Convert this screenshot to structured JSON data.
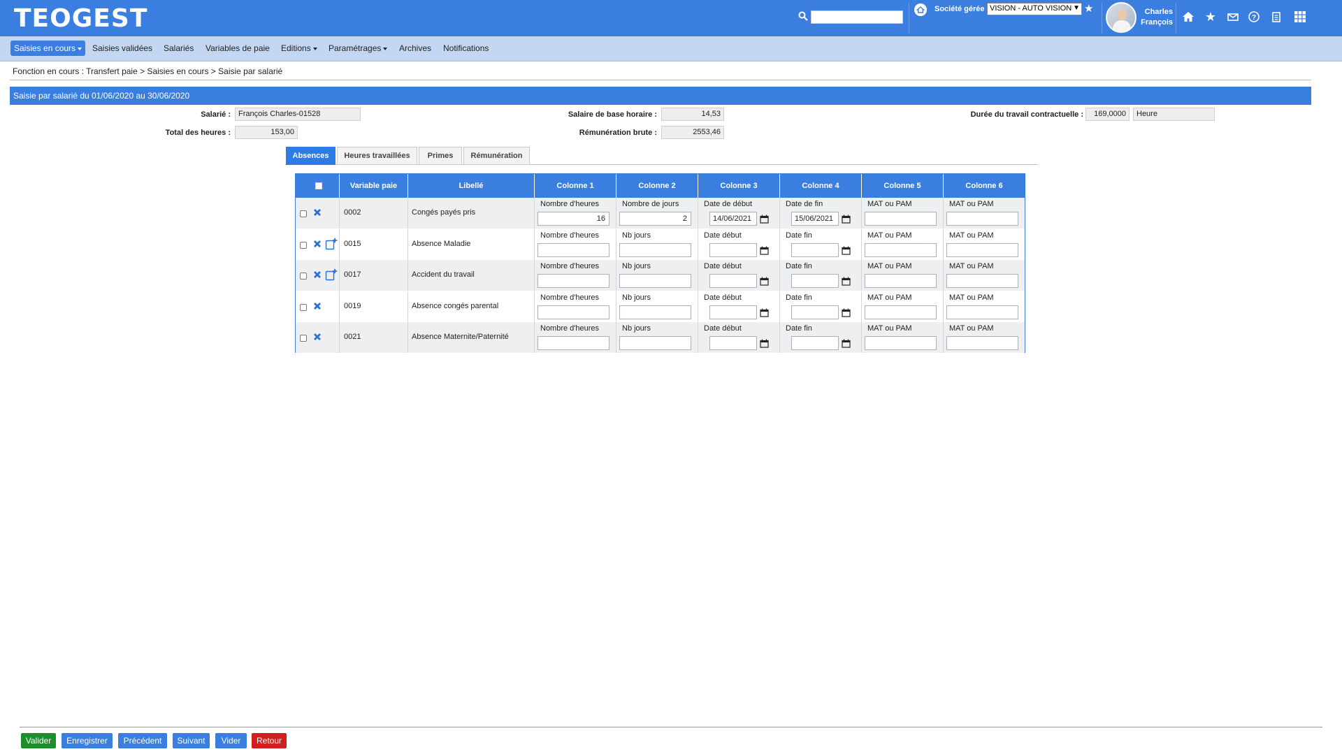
{
  "app": {
    "logo": "TEOGEST"
  },
  "header": {
    "search_placeholder": "",
    "company_label": "Société gérée :",
    "company_value": "VISION - AUTO VISION",
    "user_first": "Charles",
    "user_last": "François"
  },
  "nav": [
    {
      "label": "Saisies en cours",
      "active": true,
      "dropdown": true
    },
    {
      "label": "Saisies validées"
    },
    {
      "label": "Salariés"
    },
    {
      "label": "Variables de paie"
    },
    {
      "label": "Editions",
      "dropdown": true
    },
    {
      "label": "Paramétrages",
      "dropdown": true
    },
    {
      "label": "Archives"
    },
    {
      "label": "Notifications"
    }
  ],
  "breadcrumb": "Fonction en cours :  Transfert paie > Saisies en cours > Saisie par salarié",
  "section_title": "Saisie par salarié du 01/06/2020 au 30/06/2020",
  "info": {
    "salarie_label": "Salarié :",
    "salarie_value": "François Charles-01528",
    "total_heures_label": "Total des heures :",
    "total_heures_value": "153,00",
    "salaire_base_label": "Salaire de base horaire :",
    "salaire_base_value": "14,53",
    "remuneration_label": "Rémunération brute :",
    "remuneration_value": "2553,46",
    "duree_label": "Durée du travail contractuelle :",
    "duree_value": "169,0000",
    "duree_unit": "Heure"
  },
  "tabs": [
    "Absences",
    "Heures travaillées",
    "Primes",
    "Rémunération"
  ],
  "grid": {
    "headers": [
      "Variable paie",
      "Libellé",
      "Colonne 1",
      "Colonne 2",
      "Colonne 3",
      "Colonne 4",
      "Colonne 5",
      "Colonne 6"
    ],
    "rows": [
      {
        "code": "0002",
        "libelle": "Congés payés pris",
        "labels": [
          "Nombre d'heures",
          "Nombre de jours",
          "Date de début",
          "Date de fin",
          "MAT ou PAM",
          "MAT ou PAM"
        ],
        "values": [
          "16",
          "2",
          "14/06/2021",
          "15/06/2021",
          "",
          ""
        ],
        "add": false
      },
      {
        "code": "0015",
        "libelle": "Absence Maladie",
        "labels": [
          "Nombre d'heures",
          "Nb jours",
          "Date début",
          "Date fin",
          "MAT ou PAM",
          "MAT ou PAM"
        ],
        "values": [
          "",
          "",
          "",
          "",
          "",
          ""
        ],
        "add": true
      },
      {
        "code": "0017",
        "libelle": "Accident du travail",
        "labels": [
          "Nombre d'heures",
          "Nb jours",
          "Date début",
          "Date fin",
          "MAT ou PAM",
          "MAT ou PAM"
        ],
        "values": [
          "",
          "",
          "",
          "",
          "",
          ""
        ],
        "add": true
      },
      {
        "code": "0019",
        "libelle": "Absence congés parental",
        "labels": [
          "Nombre d'heures",
          "Nb jours",
          "Date début",
          "Date fin",
          "MAT ou PAM",
          "MAT ou PAM"
        ],
        "values": [
          "",
          "",
          "",
          "",
          "",
          ""
        ],
        "add": false
      },
      {
        "code": "0021",
        "libelle": "Absence Maternite/Paternité",
        "labels": [
          "Nombre d'heures",
          "Nb jours",
          "Date début",
          "Date fin",
          "MAT ou PAM",
          "MAT ou PAM"
        ],
        "values": [
          "",
          "",
          "",
          "",
          "",
          ""
        ],
        "add": false
      }
    ]
  },
  "footer": {
    "valider": "Valider",
    "enregistrer": "Enregistrer",
    "precedent": "Précédent",
    "suivant": "Suivant",
    "vider": "Vider",
    "retour": "Retour"
  },
  "colors": {
    "primary": "#3a7fe0",
    "nav_bg": "#c3d7f2",
    "green": "#1e8f2d",
    "red": "#d11f1f"
  },
  "icons": [
    "search-icon",
    "home-icon",
    "star-icon",
    "mail-icon",
    "help-icon",
    "clipboard-icon",
    "apps-icon",
    "delete-icon",
    "add-note-icon",
    "calendar-icon"
  ]
}
